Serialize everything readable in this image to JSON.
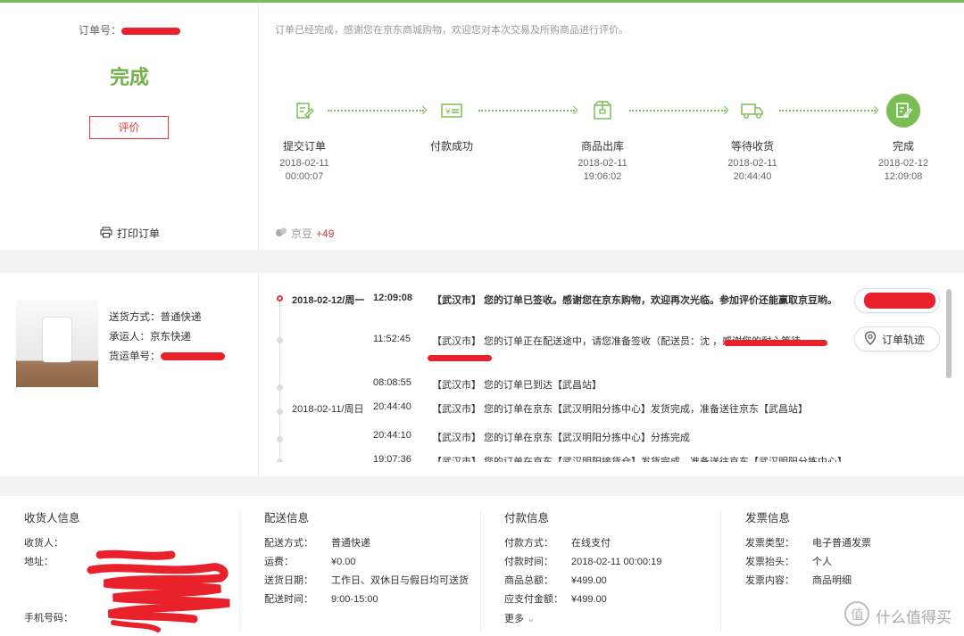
{
  "order": {
    "number_label": "订单号：",
    "status": "完成",
    "review_label": "评价",
    "print_label": "打印订单",
    "finish_message": "订单已经完成，感谢您在京东商城购物，欢迎您对本次交易及所购商品进行评价。"
  },
  "steps": [
    {
      "label": "提交订单",
      "date": "2018-02-11",
      "time": "00:00:07",
      "icon": "edit-doc-icon"
    },
    {
      "label": "付款成功",
      "date": "",
      "time": "",
      "icon": "card-icon"
    },
    {
      "label": "商品出库",
      "date": "2018-02-11",
      "time": "19:06:02",
      "icon": "package-icon"
    },
    {
      "label": "等待收货",
      "date": "2018-02-11",
      "time": "20:44:40",
      "icon": "truck-icon"
    },
    {
      "label": "完成",
      "date": "2018-02-12",
      "time": "12:09:08",
      "icon": "done-doc-icon"
    }
  ],
  "jingdou": {
    "label": "京豆",
    "value": "+49"
  },
  "shipping": {
    "method_label": "送货方式：",
    "method": "普通快递",
    "carrier_label": "承运人：",
    "carrier": "京东快递",
    "tracking_label": "货运单号："
  },
  "tracking": [
    {
      "date": "2018-02-12/周一",
      "time": "12:09:08",
      "msg": "【武汉市】 您的订单已签收。感谢您在京东购物，欢迎再次光临。参加评价还能赢取京豆哟。",
      "bold": true
    },
    {
      "date": "",
      "time": "11:52:45",
      "msg": "【武汉市】 您的订单正在配送途中，请您准备签收（配送员：沈 ，感谢您的耐心等待。"
    },
    {
      "date": "",
      "time": "08:08:55",
      "msg": "【武汉市】 您的订单已到达【武昌站】"
    },
    {
      "date": "2018-02-11/周日",
      "time": "20:44:40",
      "msg": "【武汉市】 您的订单在京东【武汉明阳分拣中心】发货完成，准备送往京东【武昌站】"
    },
    {
      "date": "",
      "time": "20:44:10",
      "msg": "【武汉市】 您的订单在京东【武汉明阳分拣中心】分拣完成"
    },
    {
      "date": "",
      "time": "19:07:36",
      "msg": "【武汉市】 您的订单在京东【武汉明阳接货仓】发货完成，准备送往京东【武汉明阳分拣中心】"
    }
  ],
  "track_btn_label": "订单轨迹",
  "receiver": {
    "title": "收货人信息",
    "name_label": "收货人：",
    "address_label": "地址：",
    "phone_label": "手机号码："
  },
  "delivery": {
    "title": "配送信息",
    "rows": [
      {
        "k": "配送方式：",
        "v": "普通快递"
      },
      {
        "k": "运费：",
        "v": "¥0.00"
      },
      {
        "k": "送货日期：",
        "v": "工作日、双休日与假日均可送货"
      },
      {
        "k": "配送时间：",
        "v": "9:00-15:00"
      }
    ]
  },
  "payment": {
    "title": "付款信息",
    "rows": [
      {
        "k": "付款方式：",
        "v": "在线支付"
      },
      {
        "k": "付款时间：",
        "v": "2018-02-11 00:00:19"
      },
      {
        "k": "商品总额：",
        "v": "¥499.00"
      },
      {
        "k": "应支付金额：",
        "v": "¥499.00"
      }
    ],
    "more": "更多"
  },
  "invoice": {
    "title": "发票信息",
    "rows": [
      {
        "k": "发票类型：",
        "v": "电子普通发票"
      },
      {
        "k": "发票抬头：",
        "v": "个人"
      },
      {
        "k": "发票内容：",
        "v": "商品明细"
      }
    ]
  },
  "watermark": "什么值得买",
  "colors": {
    "green": "#7abd54",
    "red": "#e4393c",
    "redaction": "#e8212b"
  }
}
